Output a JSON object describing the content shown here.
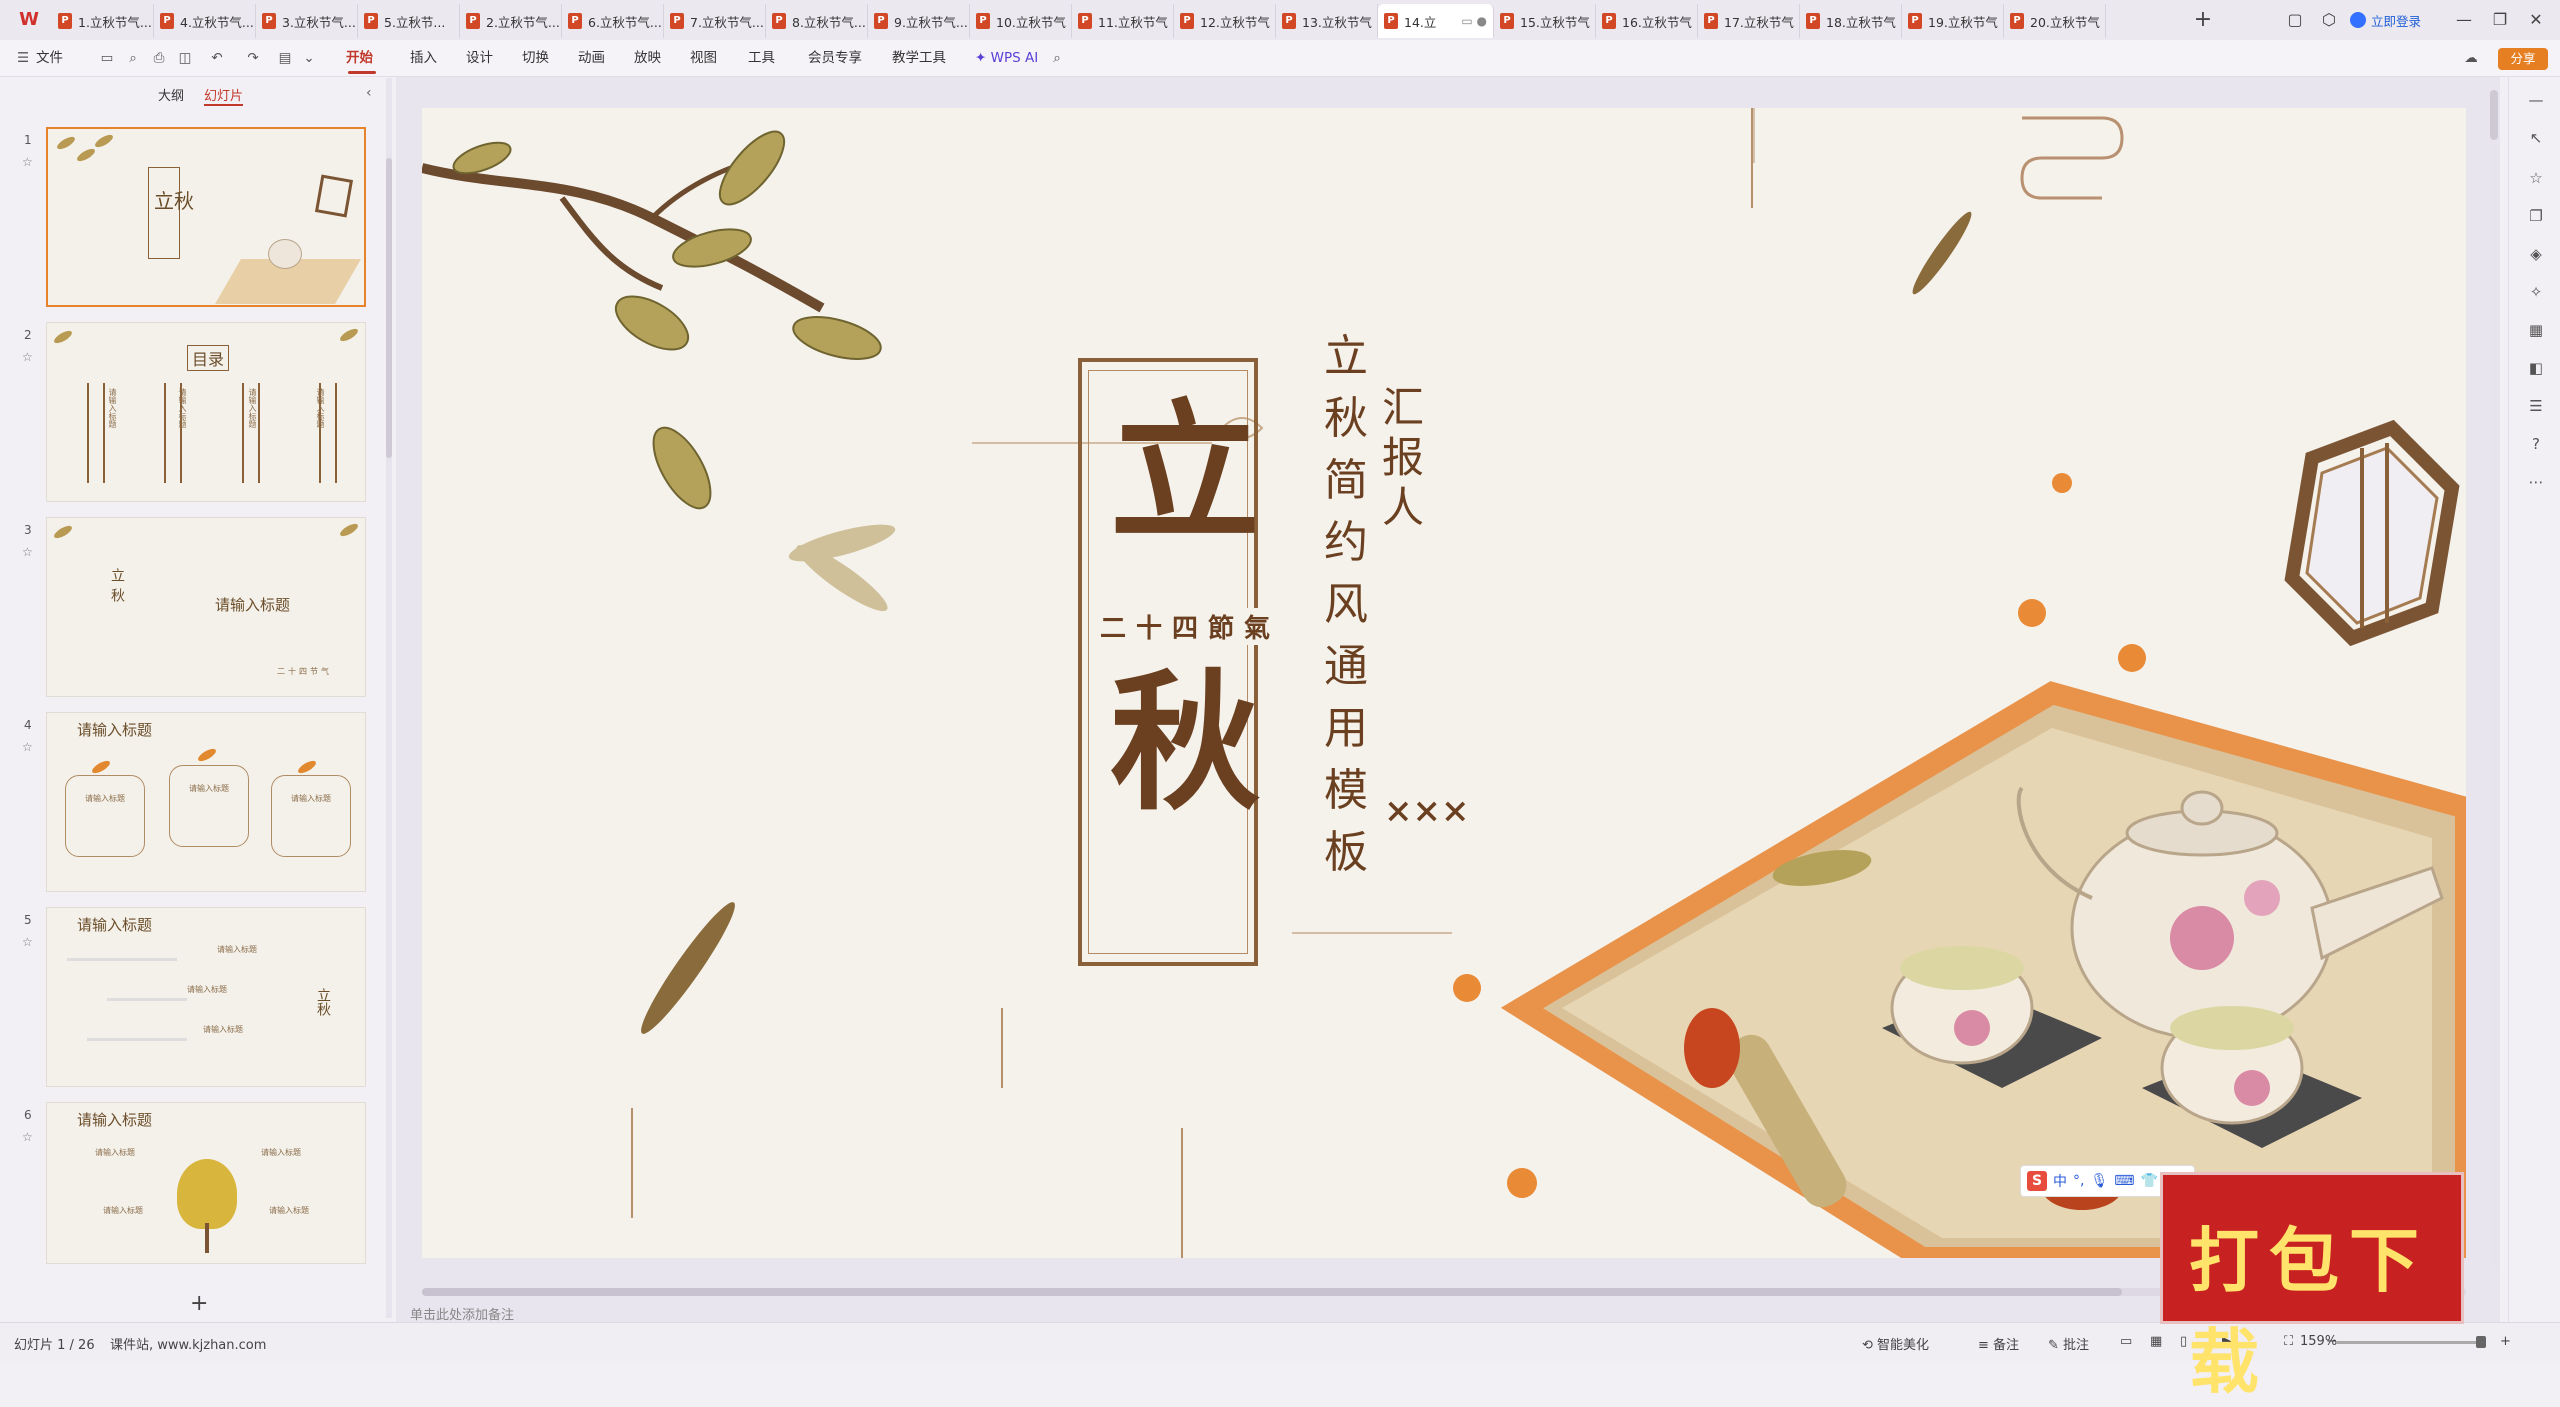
{
  "app": {
    "logo_text": "W"
  },
  "tabs": [
    {
      "label": "1.立秋节气...",
      "active": false
    },
    {
      "label": "4.立秋节气...",
      "active": false
    },
    {
      "label": "3.立秋节气...",
      "active": false
    },
    {
      "label": "5.立秋节...",
      "active": false
    },
    {
      "label": "2.立秋节气...",
      "active": false
    },
    {
      "label": "6.立秋节气...",
      "active": false
    },
    {
      "label": "7.立秋节气...",
      "active": false
    },
    {
      "label": "8.立秋节气...",
      "active": false
    },
    {
      "label": "9.立秋节气...",
      "active": false
    },
    {
      "label": "10.立秋节气",
      "active": false
    },
    {
      "label": "11.立秋节气",
      "active": false
    },
    {
      "label": "12.立秋节气",
      "active": false
    },
    {
      "label": "13.立秋节气",
      "active": false
    },
    {
      "label": "14.立",
      "active": true
    },
    {
      "label": "15.立秋节气",
      "active": false
    },
    {
      "label": "16.立秋节气",
      "active": false
    },
    {
      "label": "17.立秋节气",
      "active": false
    },
    {
      "label": "18.立秋节气",
      "active": false
    },
    {
      "label": "19.立秋节气",
      "active": false
    },
    {
      "label": "20.立秋节气",
      "active": false
    }
  ],
  "titlebar": {
    "plus": "+",
    "login": "立即登录"
  },
  "ribbon": {
    "file": "文件",
    "menus": [
      "开始",
      "插入",
      "设计",
      "切换",
      "动画",
      "放映",
      "视图",
      "工具",
      "会员专享",
      "教学工具"
    ],
    "wps_ai": "WPS AI",
    "share": "分享"
  },
  "panel": {
    "outline_tab": "大纲",
    "slides_tab": "幻灯片",
    "add": "+"
  },
  "thumbnails": [
    {
      "num": "1",
      "title": "立秋"
    },
    {
      "num": "2",
      "title": "目录",
      "items": [
        "请输入标题",
        "请输入标题",
        "请输入标题",
        "请输入标题"
      ]
    },
    {
      "num": "3",
      "title": "请输入标题",
      "sub": "立秋",
      "foot": "二十四节气"
    },
    {
      "num": "4",
      "title": "请输入标题",
      "items": [
        "请输入标题",
        "请输入标题",
        "请输入标题"
      ]
    },
    {
      "num": "5",
      "title": "请输入标题",
      "items": [
        "请输入标题",
        "请输入标题",
        "请输入标题"
      ],
      "side": "立秋"
    },
    {
      "num": "6",
      "title": "请输入标题",
      "items": [
        "请输入标题",
        "请输入标题",
        "请输入标题",
        "请输入标题"
      ]
    }
  ],
  "slide": {
    "char1": "立",
    "char2": "秋",
    "jieqi": "二十四節氣",
    "subtitle": "立秋简约风通用模板",
    "reporter": "汇报人",
    "reporter_name": "×××"
  },
  "notes_placeholder": "单击此处添加备注",
  "status": {
    "slide_info": "幻灯片 1 / 26",
    "site": "课件站, www.kjzhan.com",
    "beautify": "智能美化",
    "notes": "备注",
    "comments": "批注",
    "zoom": "159%"
  },
  "ime": {
    "s": "S",
    "mode": "中"
  },
  "download_badge": "打包下载"
}
